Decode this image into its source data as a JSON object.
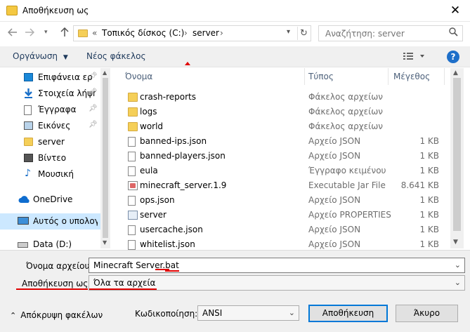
{
  "window": {
    "title": "Αποθήκευση ως",
    "close_glyph": "✕"
  },
  "address": {
    "overflow": "«",
    "segments": [
      "Τοπικός δίσκος (C:)",
      "server"
    ],
    "separators": [
      "›",
      "›"
    ]
  },
  "search": {
    "placeholder": "Αναζήτηση: server"
  },
  "toolbar": {
    "organize": "Οργάνωση",
    "new_folder": "Νέος φάκελος",
    "help": "?"
  },
  "sidebar": {
    "items": [
      {
        "label": "Επιφάνεια ερ",
        "icon": "desktop-icon",
        "pinned": true
      },
      {
        "label": "Στοιχεία λήψη",
        "icon": "download-icon",
        "pinned": true
      },
      {
        "label": "Έγγραφα",
        "icon": "documents-icon",
        "pinned": true
      },
      {
        "label": "Εικόνες",
        "icon": "pictures-icon",
        "pinned": true
      },
      {
        "label": "server",
        "icon": "folder-icon",
        "pinned": false
      },
      {
        "label": "Βίντεο",
        "icon": "videos-icon",
        "pinned": false
      },
      {
        "label": "Μουσική",
        "icon": "music-icon",
        "pinned": false
      },
      {
        "label": "OneDrive",
        "icon": "onedrive-icon",
        "pinned": false
      },
      {
        "label": "Αυτός ο υπολογισ",
        "icon": "computer-icon",
        "pinned": false
      },
      {
        "label": "Data (D:)",
        "icon": "drive-icon",
        "pinned": false
      }
    ]
  },
  "columns": {
    "name": "Όνομα",
    "type": "Τύπος",
    "size": "Μέγεθος"
  },
  "files": [
    {
      "name": "crash-reports",
      "type": "Φάκελος αρχείων",
      "size": "",
      "icon": "folder-icon"
    },
    {
      "name": "logs",
      "type": "Φάκελος αρχείων",
      "size": "",
      "icon": "folder-icon"
    },
    {
      "name": "world",
      "type": "Φάκελος αρχείων",
      "size": "",
      "icon": "folder-icon"
    },
    {
      "name": "banned-ips.json",
      "type": "Αρχείο JSON",
      "size": "1 KB",
      "icon": "file-icon"
    },
    {
      "name": "banned-players.json",
      "type": "Αρχείο JSON",
      "size": "1 KB",
      "icon": "file-icon"
    },
    {
      "name": "eula",
      "type": "Έγγραφο κειμένου",
      "size": "1 KB",
      "icon": "text-file-icon"
    },
    {
      "name": "minecraft_server.1.9",
      "type": "Executable Jar File",
      "size": "8.641 KB",
      "icon": "jar-icon"
    },
    {
      "name": "ops.json",
      "type": "Αρχείο JSON",
      "size": "1 KB",
      "icon": "file-icon"
    },
    {
      "name": "server",
      "type": "Αρχείο PROPERTIES",
      "size": "1 KB",
      "icon": "properties-icon"
    },
    {
      "name": "usercache.json",
      "type": "Αρχείο JSON",
      "size": "1 KB",
      "icon": "file-icon"
    },
    {
      "name": "whitelist.json",
      "type": "Αρχείο JSON",
      "size": "1 KB",
      "icon": "file-icon"
    }
  ],
  "form": {
    "filename_label": "Όνομα αρχείου:",
    "filename_value_base": "Minecraft Server.",
    "filename_value_ext": "bat",
    "savetype_label": "Αποθήκευση ως:",
    "savetype_value": "Όλα τα αρχεία",
    "encoding_label": "Κωδικοποίηση:",
    "encoding_value": "ANSI"
  },
  "buttons": {
    "hide_folders": "Απόκρυψη φακέλων",
    "save": "Αποθήκευση",
    "cancel": "Άκυρο"
  },
  "colors": {
    "annotation": "#e00000",
    "selection": "#cce8ff",
    "accent": "#0078d7"
  }
}
